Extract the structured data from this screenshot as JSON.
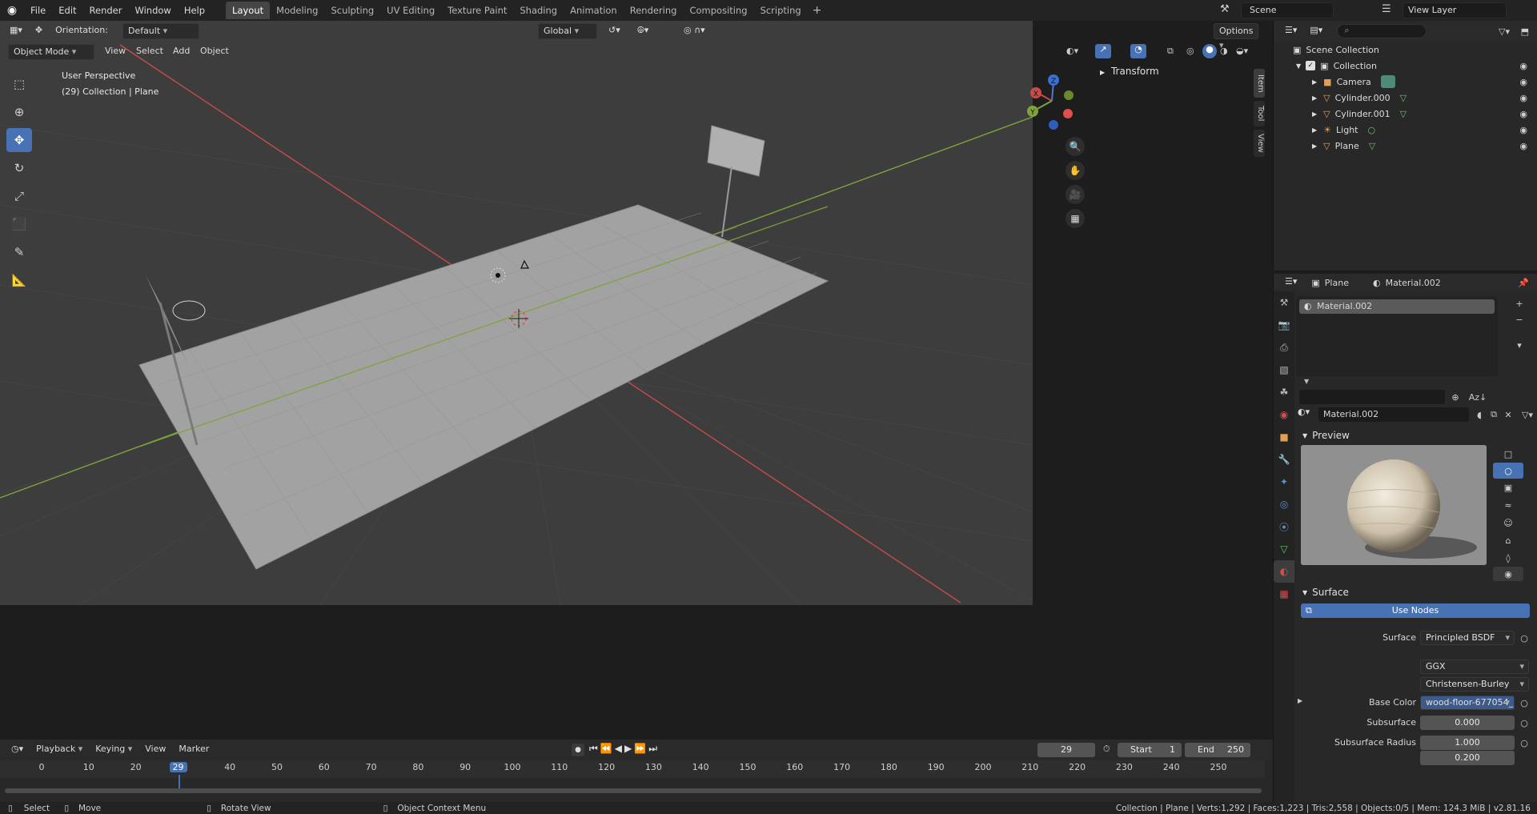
{
  "app": {
    "menus": [
      "File",
      "Edit",
      "Render",
      "Window",
      "Help"
    ],
    "workspaces": [
      "Layout",
      "Modeling",
      "Sculpting",
      "UV Editing",
      "Texture Paint",
      "Shading",
      "Animation",
      "Rendering",
      "Compositing",
      "Scripting"
    ],
    "active_workspace": "Layout",
    "add_tab": "+",
    "scene": "Scene",
    "view_layer": "View Layer"
  },
  "viewport": {
    "orientation_label": "Orientation:",
    "orientation_value": "Default",
    "transform_space": "Global",
    "options_label": "Options",
    "mode": "Object Mode",
    "menus": [
      "View",
      "Select",
      "Add",
      "Object"
    ],
    "overlay_line1": "User Perspective",
    "overlay_line2": "(29) Collection | Plane",
    "sidebar_panel": "Transform",
    "side_tabs": [
      "Item",
      "Tool",
      "View"
    ],
    "gizmo_axes": {
      "x": "X",
      "y": "Y",
      "z": "Z"
    },
    "colors": {
      "bg": "#3d3d3d",
      "plane": "#a2a2a2",
      "x_axis": "#c84b4b",
      "y_axis": "#7fa33a",
      "accent": "#4772b3"
    }
  },
  "timeline": {
    "menus": [
      "Playback",
      "Keying",
      "View",
      "Marker"
    ],
    "current_frame": "29",
    "start_label": "Start",
    "start_value": "1",
    "end_label": "End",
    "end_value": "250",
    "ticks": [
      "0",
      "10",
      "20",
      "29",
      "40",
      "50",
      "60",
      "70",
      "80",
      "90",
      "100",
      "110",
      "120",
      "130",
      "140",
      "150",
      "160",
      "170",
      "180",
      "190",
      "200",
      "210",
      "220",
      "230",
      "240",
      "250"
    ]
  },
  "statusbar": {
    "select": "Select",
    "move": "Move",
    "rotate": "Rotate View",
    "context": "Object Context Menu",
    "stats": "Collection | Plane | Verts:1,292 | Faces:1,223 | Tris:2,558 | Objects:0/5 | Mem: 124.3 MiB | v2.81.16"
  },
  "outliner": {
    "root": "Scene Collection",
    "collection": "Collection",
    "items": [
      {
        "name": "Camera",
        "icon": "camera-icon",
        "data_icon": "camera-data-icon"
      },
      {
        "name": "Cylinder.000",
        "icon": "mesh-object-icon",
        "data_icon": "mesh-data-icon"
      },
      {
        "name": "Cylinder.001",
        "icon": "mesh-object-icon",
        "data_icon": "mesh-data-icon"
      },
      {
        "name": "Light",
        "icon": "light-icon",
        "data_icon": "light-data-icon"
      },
      {
        "name": "Plane",
        "icon": "mesh-object-icon",
        "data_icon": "mesh-data-icon"
      }
    ]
  },
  "properties": {
    "object": "Plane",
    "material": "Material.002",
    "slot": "Material.002",
    "material_field": "Material.002",
    "preview_title": "Preview",
    "surface_title": "Surface",
    "use_nodes": "Use Nodes",
    "surface_label": "Surface",
    "surface_value": "Principled BSDF",
    "distribution": "GGX",
    "subsurface_method": "Christensen-Burley",
    "base_color_label": "Base Color",
    "base_color_value": "wood-floor-677054_...",
    "subsurface_label": "Subsurface",
    "subsurface_value": "0.000",
    "subsurface_radius_label": "Subsurface Radius",
    "subsurface_radius_1": "1.000",
    "subsurface_radius_2": "0.200",
    "sort_label": "Az"
  }
}
